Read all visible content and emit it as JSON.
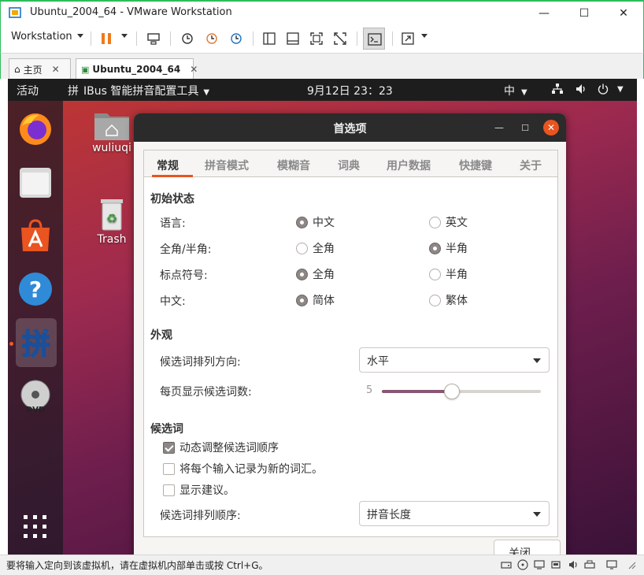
{
  "window": {
    "title": "Ubuntu_2004_64 - VMware Workstation",
    "accent": "#2dbd5b"
  },
  "toolbar": {
    "menu_label": "Workstation"
  },
  "tabs": [
    {
      "label": "主页"
    },
    {
      "label": "Ubuntu_2004_64"
    }
  ],
  "topbar": {
    "activities": "活动",
    "ime_app": "IBus 智能拼音配置工具",
    "clock": "9月12日  23：23",
    "ime_indicator": "中"
  },
  "desktop": {
    "home_label": "wuliuqi",
    "trash_label": "Trash"
  },
  "dock_icons": [
    "firefox-icon",
    "files-icon",
    "software-icon",
    "help-icon",
    "pinyin-icon",
    "dvd-icon",
    "app-grid-icon"
  ],
  "dialog": {
    "title": "首选项",
    "tabs": [
      "常规",
      "拼音模式",
      "模糊音",
      "词典",
      "用户数据",
      "快捷键",
      "关于"
    ],
    "sections": {
      "initial": "初始状态",
      "appearance": "外观",
      "candidates": "候选词"
    },
    "initial_rows": [
      {
        "label": "语言:",
        "opt1": "中文",
        "opt2": "英文",
        "selected": 1
      },
      {
        "label": "全角/半角:",
        "opt1": "全角",
        "opt2": "半角",
        "selected": 2
      },
      {
        "label": "标点符号:",
        "opt1": "全角",
        "opt2": "半角",
        "selected": 1
      },
      {
        "label": "中文:",
        "opt1": "简体",
        "opt2": "繁体",
        "selected": 1
      }
    ],
    "orientation_label": "候选词排列方向:",
    "orientation_value": "水平",
    "page_size_label": "每页显示候选词数:",
    "page_size_value": "5",
    "page_size_fraction": 0.44,
    "checks": [
      {
        "label": "动态调整候选词顺序",
        "checked": true
      },
      {
        "label": "将每个输入记录为新的词汇。",
        "checked": false
      },
      {
        "label": "显示建议。",
        "checked": false
      }
    ],
    "sort_label": "候选词排列顺序:",
    "sort_value": "拼音长度",
    "close_label": "关闭(C)"
  },
  "statusbar": {
    "message": "要将输入定向到该虚拟机，请在虚拟机内部单击或按 Ctrl+G。"
  },
  "colors": {
    "ubuntu_orange": "#e95420",
    "slider_fill": "#8a5673"
  }
}
